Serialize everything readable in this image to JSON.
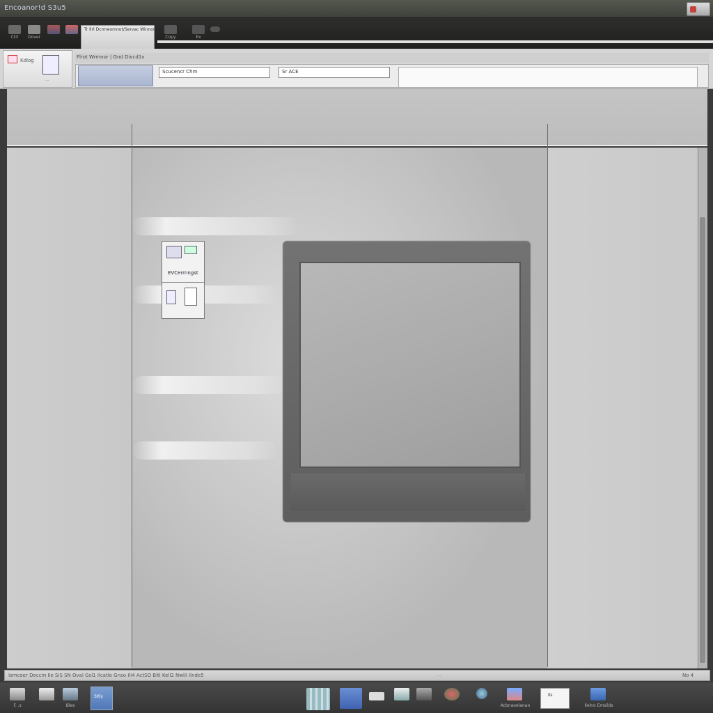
{
  "window": {
    "title": "Encoanor!d S3u5"
  },
  "toolbar": {
    "buttons": [
      {
        "label": "Ctrl",
        "icon": "cursor-icon"
      },
      {
        "label": "Dover",
        "icon": "document-icon"
      },
      {
        "label": "",
        "icon": "image-icon"
      },
      {
        "label": "",
        "icon": "picture-icon"
      },
      {
        "label": "Copy",
        "icon": "copy-icon"
      },
      {
        "label": "Ex",
        "icon": "export-icon"
      }
    ],
    "active_tab": "Tr Ilrl Dcrmeomnot/Servac Winnor"
  },
  "ribbon": {
    "group_label": "Kdlog",
    "group_footer": "...",
    "strip_text": "Flrot Wrmnor | Gnd Divcd1v",
    "input1": "Scucencr Chm",
    "input2": "Sr ACE",
    "colors": {
      "accent": "#aab6d0"
    }
  },
  "thumbnail": {
    "label": "EVCerrnngst"
  },
  "status": {
    "left": "Ismcoer Deccm  Ile  SiS  SN  Oval  Gsl1  Ilcatle  Gnso  Ili4  ActSO  Bltl  Kell2  Nwlil  Ilnde5",
    "center": "...",
    "right": "No 4"
  },
  "taskbar": {
    "items": [
      {
        "label": "F. .s",
        "icon": "film-icon"
      },
      {
        "label": "",
        "icon": "stack-icon"
      },
      {
        "label": "Bles",
        "icon": "scanner-icon"
      },
      {
        "label": "",
        "icon": "grid-icon"
      },
      {
        "label": "",
        "icon": "screen-icon"
      },
      {
        "label": "",
        "icon": "keyboard-icon"
      },
      {
        "label": "",
        "icon": "photo-icon"
      },
      {
        "label": "",
        "icon": "camera-icon"
      },
      {
        "label": "",
        "icon": "globe-icon"
      },
      {
        "label": "",
        "icon": "gear-icon"
      },
      {
        "label": "Acbnaoelanan",
        "icon": "chart-icon"
      },
      {
        "label": "Ilelno Emsilds",
        "icon": "folder-icon"
      }
    ],
    "active_label": "Stlly",
    "white_label": "Ils"
  }
}
